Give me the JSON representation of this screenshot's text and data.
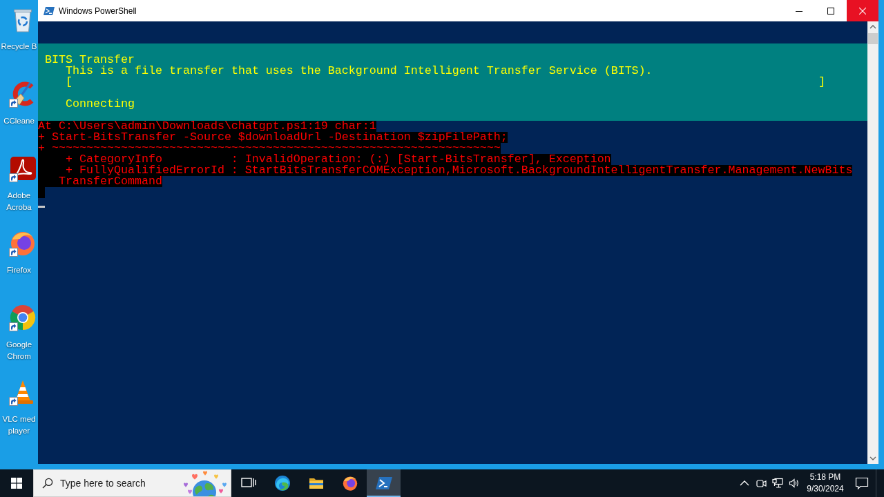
{
  "desktop": {
    "icons": [
      {
        "kind": "recycle-bin",
        "label": "Recycle B",
        "shortcut": false
      },
      {
        "kind": "ccleaner",
        "label": "CCleane",
        "shortcut": true
      },
      {
        "kind": "acrobat",
        "label": "Adobe Acroba",
        "shortcut": true
      },
      {
        "kind": "firefox",
        "label": "Firefox",
        "shortcut": true
      },
      {
        "kind": "chrome",
        "label": "Google Chrom",
        "shortcut": true
      },
      {
        "kind": "vlc",
        "label": "VLC med player",
        "shortcut": true
      }
    ]
  },
  "window": {
    "title": "Windows PowerShell",
    "progress": {
      "heading": "BITS Transfer",
      "description": "This is a file transfer that uses the Background Intelligent Transfer Service (BITS).",
      "bar_start": "[",
      "bar_end": "]",
      "level": 0,
      "status": "Connecting"
    },
    "error_lines": [
      "At C:\\Users\\admin\\Downloads\\chatgpt.ps1:19 char:1",
      "+ Start-BitsTransfer -Source $downloadUrl -Destination $zipFilePath;",
      "+ ~~~~~~~~~~~~~~~~~~~~~~~~~~~~~~~~~~~~~~~~~~~~~~~~~~~~~~~~~~~~~~~~~",
      "    + CategoryInfo          : InvalidOperation: (:) [Start-BitsTransfer], Exception",
      "    + FullyQualifiedErrorId : StartBitsTransferCOMException,Microsoft.BackgroundIntelligentTransfer.Management.NewBits",
      "   TransferCommand"
    ]
  },
  "taskbar": {
    "search": {
      "placeholder": "Type here to search"
    },
    "apps": [
      {
        "kind": "task-view",
        "selected": false
      },
      {
        "kind": "edge",
        "selected": false
      },
      {
        "kind": "explorer",
        "selected": false
      },
      {
        "kind": "firefox",
        "selected": false
      },
      {
        "kind": "powershell",
        "selected": true
      }
    ],
    "clock": {
      "time": "5:18 PM",
      "date": "9/30/2024"
    }
  }
}
